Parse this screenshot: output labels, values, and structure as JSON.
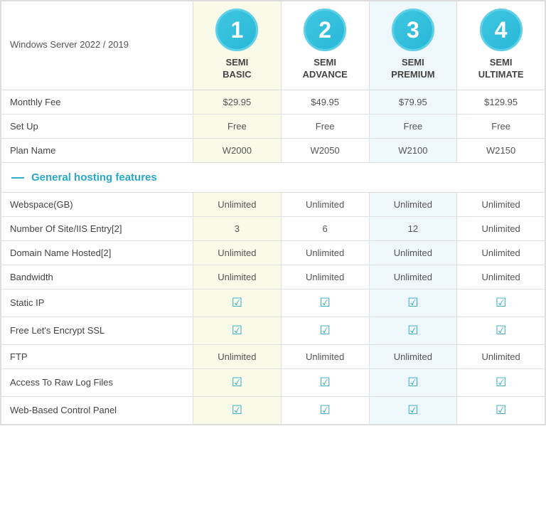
{
  "header": {
    "os_label": "Windows Server 2022 / 2019",
    "plans": [
      {
        "number": "1",
        "name_line1": "SEMI",
        "name_line2": "BASIC"
      },
      {
        "number": "2",
        "name_line1": "SEMI",
        "name_line2": "ADVANCE"
      },
      {
        "number": "3",
        "name_line1": "SEMI",
        "name_line2": "PREMIUM"
      },
      {
        "number": "4",
        "name_line1": "SEMI",
        "name_line2": "ULTIMATE"
      }
    ]
  },
  "basic_rows": [
    {
      "label": "Monthly Fee",
      "values": [
        "$29.95",
        "$49.95",
        "$79.95",
        "$129.95"
      ]
    },
    {
      "label": "Set Up",
      "values": [
        "Free",
        "Free",
        "Free",
        "Free"
      ]
    },
    {
      "label": "Plan Name",
      "values": [
        "W2000",
        "W2050",
        "W2100",
        "W2150"
      ]
    }
  ],
  "section_title": "General hosting features",
  "section_dash": "—",
  "feature_rows": [
    {
      "label": "Webspace(GB)",
      "values": [
        "Unlimited",
        "Unlimited",
        "Unlimited",
        "Unlimited"
      ],
      "type": "text"
    },
    {
      "label": "Number Of Site/IIS Entry[2]",
      "values": [
        "3",
        "6",
        "12",
        "Unlimited"
      ],
      "type": "text"
    },
    {
      "label": "Domain Name Hosted[2]",
      "values": [
        "Unlimited",
        "Unlimited",
        "Unlimited",
        "Unlimited"
      ],
      "type": "text"
    },
    {
      "label": "Bandwidth",
      "values": [
        "Unlimited",
        "Unlimited",
        "Unlimited",
        "Unlimited"
      ],
      "type": "text"
    },
    {
      "label": "Static IP",
      "values": [
        "check",
        "check",
        "check",
        "check"
      ],
      "type": "check"
    },
    {
      "label": "Free Let's Encrypt SSL",
      "values": [
        "check",
        "check",
        "check",
        "check"
      ],
      "type": "check"
    },
    {
      "label": "FTP",
      "values": [
        "Unlimited",
        "Unlimited",
        "Unlimited",
        "Unlimited"
      ],
      "type": "text"
    },
    {
      "label": "Access To Raw Log Files",
      "values": [
        "check",
        "check",
        "check",
        "check"
      ],
      "type": "check"
    },
    {
      "label": "Web-Based Control Panel",
      "values": [
        "check",
        "check",
        "check",
        "check"
      ],
      "type": "check"
    }
  ],
  "check_char": "☑"
}
